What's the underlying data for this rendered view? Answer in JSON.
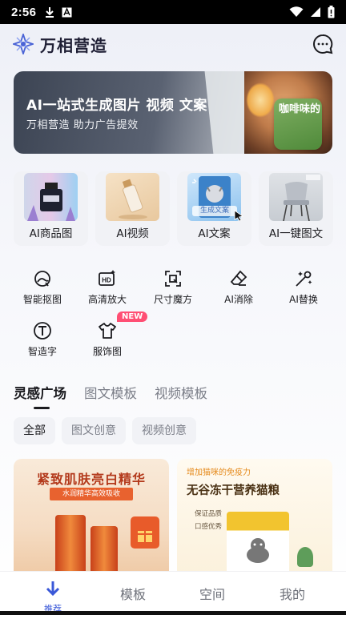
{
  "status_bar": {
    "time": "2:56"
  },
  "header": {
    "brand": "万相营造"
  },
  "banner": {
    "title": "AI一站式生成图片 视频 文案",
    "subtitle": "万相营造 助力广告提效",
    "card_text": "咖啡味的",
    "page_count": 3,
    "active_page": 1
  },
  "features": [
    {
      "label": "AI商品图"
    },
    {
      "label": "AI视频"
    },
    {
      "label": "AI文案"
    },
    {
      "label": "AI一键图文"
    }
  ],
  "feature_overlay": {
    "ai_copy_tag": "生成文案"
  },
  "tools": [
    {
      "label": "智能抠图",
      "icon": "smart-cutout-icon"
    },
    {
      "label": "高清放大",
      "icon": "hd-upscale-icon"
    },
    {
      "label": "尺寸魔方",
      "icon": "resize-icon"
    },
    {
      "label": "AI消除",
      "icon": "eraser-icon"
    },
    {
      "label": "AI替换",
      "icon": "magic-wand-icon"
    },
    {
      "label": "智造字",
      "icon": "text-t-icon"
    },
    {
      "label": "服饰图",
      "icon": "shirt-icon"
    }
  ],
  "new_badge": "NEW",
  "tabs": [
    {
      "label": "灵感广场",
      "active": true
    },
    {
      "label": "图文模板",
      "active": false
    },
    {
      "label": "视频模板",
      "active": false
    }
  ],
  "chips": [
    {
      "label": "全部",
      "active": true
    },
    {
      "label": "图文创意",
      "active": false
    },
    {
      "label": "视频创意",
      "active": false
    }
  ],
  "posts": [
    {
      "headline": "紧致肌肤亮白精华",
      "sub": "水润精华高效吸收"
    },
    {
      "small": "增加猫咪的免疫力",
      "headline": "无谷冻干营养猫粮",
      "bullets": [
        "保证品质",
        "口感优秀"
      ]
    }
  ],
  "bottom_nav": [
    {
      "label": "推荐",
      "active": true
    },
    {
      "label": "模板",
      "active": false
    },
    {
      "label": "空间",
      "active": false
    },
    {
      "label": "我的",
      "active": false
    }
  ],
  "colors": {
    "accent": "#3a58d8",
    "badge": "#ff4f74",
    "text": "#1b1b1f",
    "muted": "#7b7e88"
  }
}
